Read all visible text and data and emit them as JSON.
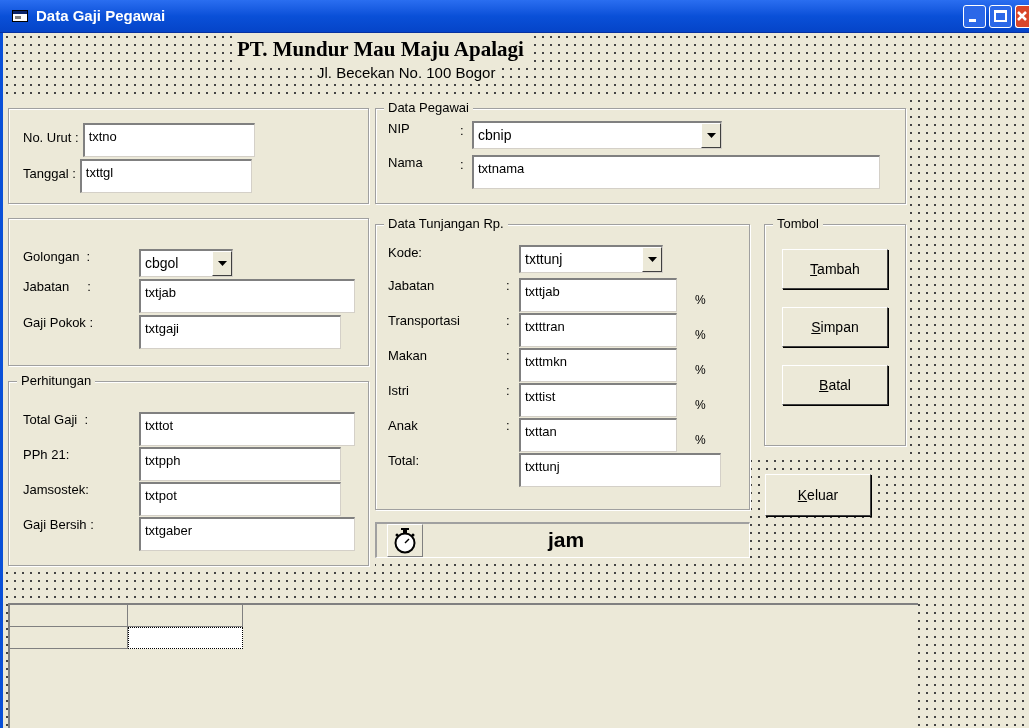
{
  "window": {
    "title": "Data Gaji Pegawai"
  },
  "header": {
    "company": "PT. Mundur Mau Maju Apalagi",
    "address": "Jl. Becekan No. 100 Bogor"
  },
  "frame_nomor": {
    "fields": [
      {
        "kind": "text",
        "label": "No. Urut :",
        "value": "txtno"
      },
      {
        "kind": "text",
        "label": "Tanggal :",
        "value": "txttgl"
      }
    ]
  },
  "frame_gaji": {
    "fields": [
      {
        "kind": "combo",
        "label": "Golongan  :",
        "value": "cbgol"
      },
      {
        "kind": "text",
        "label": "Jabatan     :",
        "value": "txtjab"
      },
      {
        "kind": "text",
        "label": "Gaji Pokok :",
        "value": "txtgaji"
      }
    ]
  },
  "perhitungan": {
    "title": "Perhitungan",
    "fields": [
      {
        "kind": "text",
        "label": "Total Gaji  :",
        "value": "txttot"
      },
      {
        "kind": "text",
        "label": "PPh 21:",
        "value": "txtpph"
      },
      {
        "kind": "text",
        "label": "Jamsostek:",
        "value": "txtpot"
      },
      {
        "kind": "text",
        "label": "Gaji Bersih :",
        "value": "txtgaber"
      }
    ]
  },
  "data_pegawai": {
    "title": "Data Pegawai",
    "fields": [
      {
        "kind": "combo",
        "label": "NIP",
        "separator": ":",
        "value": "cbnip"
      },
      {
        "kind": "text",
        "label": "Nama",
        "separator": ":",
        "value": "txtnama"
      }
    ]
  },
  "data_tunjangan": {
    "title": "Data Tunjangan Rp.",
    "fields": [
      {
        "kind": "combo",
        "label": "Kode:",
        "value": "txttunj"
      },
      {
        "kind": "percent",
        "label": "Jabatan",
        "separator": ":",
        "value": "txttjab",
        "unit": "%"
      },
      {
        "kind": "percent",
        "label": "Transportasi",
        "separator": ":",
        "value": "txtttran",
        "unit": "%"
      },
      {
        "kind": "percent",
        "label": "Makan",
        "separator": ":",
        "value": "txttmkn",
        "unit": "%"
      },
      {
        "kind": "percent",
        "label": "Istri",
        "separator": ":",
        "value": "txttist",
        "unit": "%"
      },
      {
        "kind": "percent",
        "label": "Anak",
        "separator": ":",
        "value": "txttan",
        "unit": "%"
      },
      {
        "kind": "text",
        "label": "Total:",
        "value": "txttunj"
      }
    ]
  },
  "tombol": {
    "title": "Tombol",
    "buttons": [
      {
        "label": "Tambah"
      },
      {
        "label": "Simpan"
      },
      {
        "label": "Batal"
      }
    ]
  },
  "keluar_button": {
    "label": "Keluar"
  },
  "clock": {
    "label": "jam"
  }
}
